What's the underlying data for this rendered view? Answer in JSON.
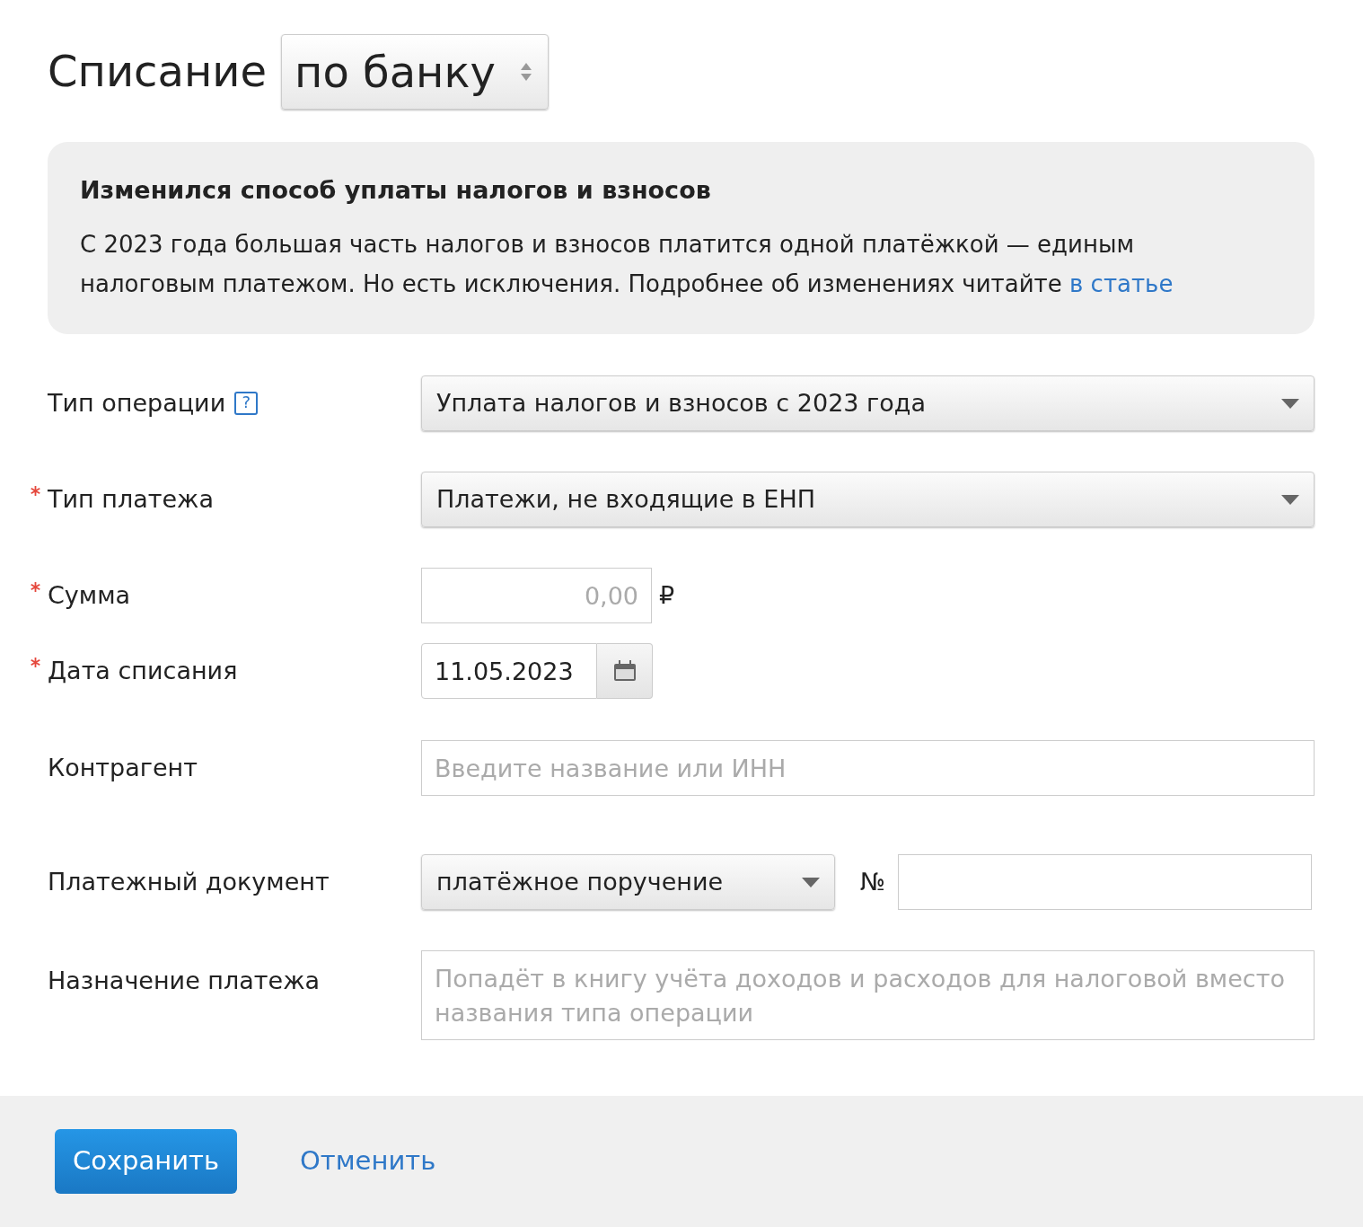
{
  "header": {
    "title": "Списание",
    "mode": "по банку"
  },
  "notice": {
    "title": "Изменился способ уплаты налогов и взносов",
    "text": "С 2023 года большая часть налогов и взносов платится одной платёжкой — единым налоговым платежом. Но есть исключения. Подробнее об изменениях читайте",
    "link": "в статье"
  },
  "fields": [
    {
      "kind": "select",
      "label": "Тип операции",
      "required": false,
      "help": "?",
      "value": "Уплата налогов и взносов с 2023 года"
    },
    {
      "kind": "select",
      "label": "Тип платежа",
      "required": true,
      "value": "Платежи, не входящие в ЕНП"
    },
    {
      "kind": "money",
      "label": "Сумма",
      "required": true,
      "placeholder": "0,00",
      "currency": "₽"
    },
    {
      "kind": "date",
      "label": "Дата списания",
      "required": true,
      "value": "11.05.2023"
    },
    {
      "kind": "text",
      "label": "Контрагент",
      "required": false,
      "placeholder": "Введите название или ИНН"
    },
    {
      "kind": "doc",
      "label": "Платежный документ",
      "required": false,
      "value": "платёжное поручение",
      "number_label": "№"
    },
    {
      "kind": "textarea",
      "label": "Назначение платежа",
      "required": false,
      "placeholder": "Попадёт в книгу учёта доходов и расходов для налоговой вместо названия типа операции"
    }
  ],
  "footer": {
    "save": "Сохранить",
    "cancel": "Отменить"
  }
}
